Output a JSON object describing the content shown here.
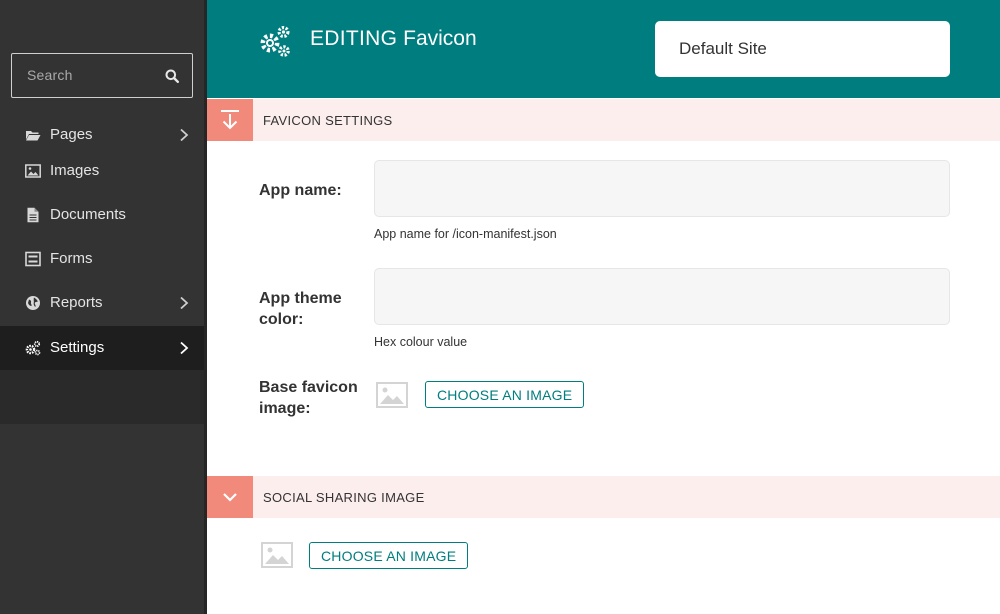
{
  "sidebar": {
    "search_placeholder": "Search",
    "items": [
      {
        "label": "Pages",
        "icon": "folder-open-icon",
        "has_children": true
      },
      {
        "label": "Images",
        "icon": "image-icon",
        "has_children": false
      },
      {
        "label": "Documents",
        "icon": "document-icon",
        "has_children": false
      },
      {
        "label": "Forms",
        "icon": "form-icon",
        "has_children": false
      },
      {
        "label": "Reports",
        "icon": "globe-icon",
        "has_children": true
      },
      {
        "label": "Settings",
        "icon": "cogs-icon",
        "has_children": true,
        "active": true
      }
    ]
  },
  "header": {
    "title_prefix": "EDITING",
    "title_name": "Favicon",
    "site_select_value": "Default Site"
  },
  "sections": {
    "favicon": {
      "title": "FAVICON SETTINGS",
      "fields": {
        "app_name": {
          "label": "App name:",
          "value": "",
          "help": "App name for /icon-manifest.json"
        },
        "theme_color": {
          "label": "App theme color:",
          "label_line1": "App theme",
          "label_line2": "color:",
          "value": "",
          "help": "Hex colour value"
        },
        "base_favicon": {
          "label_line1": "Base favicon",
          "label_line2": "image:",
          "button": "CHOOSE AN IMAGE"
        }
      }
    },
    "social": {
      "title": "SOCIAL SHARING IMAGE",
      "button": "CHOOSE AN IMAGE"
    }
  },
  "colors": {
    "brand_teal": "#007d7e",
    "accent_salmon": "#f28a7c",
    "section_bg": "#fdeeee",
    "sidebar_bg": "#333333"
  }
}
